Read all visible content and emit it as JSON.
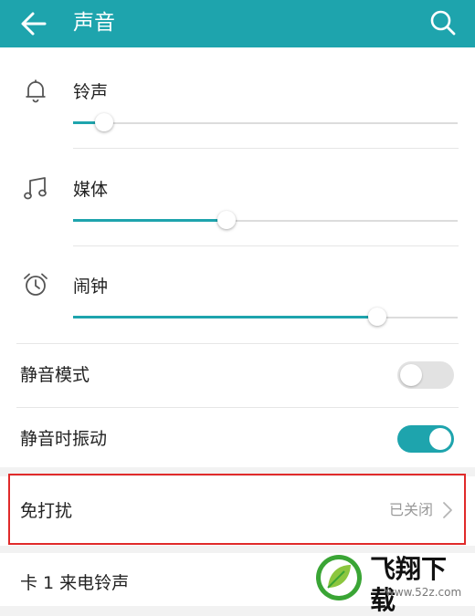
{
  "app_bar": {
    "title": "声音",
    "back_icon": "arrow-left-icon",
    "search_icon": "search-icon",
    "color": "#1ea4ad"
  },
  "volumes": [
    {
      "label": "铃声",
      "icon": "bell-icon",
      "level": 0.08
    },
    {
      "label": "媒体",
      "icon": "music-note-icon",
      "level": 0.4
    },
    {
      "label": "闹钟",
      "icon": "alarm-clock-icon",
      "level": 0.79
    }
  ],
  "toggles": [
    {
      "label": "静音模式",
      "on": false
    },
    {
      "label": "静音时振动",
      "on": true
    }
  ],
  "do_not_disturb": {
    "label": "免打扰",
    "value": "已关闭"
  },
  "sim_ringtone": {
    "label": "卡 1 来电铃声"
  },
  "watermark": {
    "title": "飞翔下载",
    "url": "www.52z.com",
    "icon": "leaf-logo-icon"
  },
  "colors": {
    "accent": "#1ea4ad",
    "highlight": "#e02a2a"
  }
}
